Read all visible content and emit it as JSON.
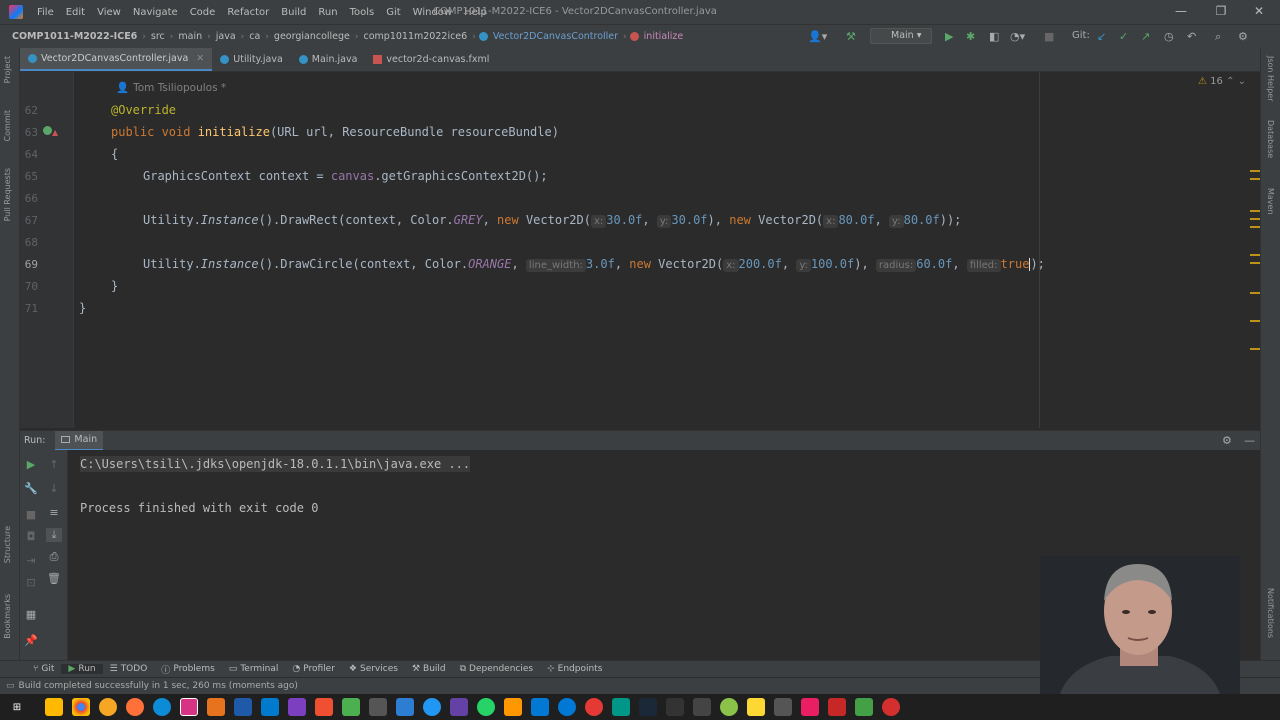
{
  "menu": [
    "File",
    "Edit",
    "View",
    "Navigate",
    "Code",
    "Refactor",
    "Build",
    "Run",
    "Tools",
    "Git",
    "Window",
    "Help"
  ],
  "window_title": "COMP1011-M2022-ICE6 - Vector2DCanvasController.java",
  "window_controls": {
    "minimize": "—",
    "maximize": "❐",
    "close": "✕"
  },
  "breadcrumbs": [
    "COMP1011-M2022-ICE6",
    "src",
    "main",
    "java",
    "ca",
    "georgiancollege",
    "comp1011m2022ice6",
    "Vector2DCanvasController",
    "initialize"
  ],
  "toolbar": {
    "run_config": "Main",
    "git_label": "Git:"
  },
  "tabs": [
    "Vector2DCanvasController.java",
    "Utility.java",
    "Main.java",
    "vector2d-canvas.fxml"
  ],
  "left_stripe": [
    "Project",
    "Commit",
    "Pull Requests",
    "Structure",
    "Bookmarks"
  ],
  "right_stripe": [
    "Json Helper",
    "Database",
    "Maven",
    "Notifications"
  ],
  "editor": {
    "author": "Tom Tsiliopoulos *",
    "warnings_count": "16",
    "line_numbers": [
      "62",
      "63",
      "64",
      "65",
      "66",
      "67",
      "68",
      "69",
      "70",
      "71"
    ],
    "code": {
      "l62": "@Override",
      "l63_kw": "public void ",
      "l63_fn": "initialize",
      "l63_rest": "(URL url, ResourceBundle resourceBundle)",
      "l64": "{",
      "l65_a": "GraphicsContext context = ",
      "l65_field": "canvas",
      "l65_b": ".getGraphicsContext2D();",
      "util": "Utility.",
      "instance": "Instance",
      "l67_call": "().DrawRect(context, Color.",
      "l67_color": "GREY",
      "new": "new",
      "vec": " Vector2D(",
      "hint_x": "x:",
      "hint_y": "y:",
      "l67_x1": "30.0f",
      "l67_y1": "30.0f",
      "l67_x2": "80.0f",
      "l67_y2": "80.0f",
      "close_paren": ")",
      "comma": ", ",
      "l67_end": "));",
      "l69_call": "().DrawCircle(context, Color.",
      "l69_color": "ORANGE",
      "hint_line_width": "line_width:",
      "l69_lw": "3.0f",
      "l69_x": "200.0f",
      "l69_y": "100.0f",
      "hint_radius": "radius:",
      "l69_radius": "60.0f",
      "hint_filled": "filled:",
      "l69_filled": "true",
      "l69_end": ");",
      "l70": "}",
      "l71": "}"
    }
  },
  "run": {
    "label": "Run:",
    "config": "Main",
    "command": "C:\\Users\\tsili\\.jdks\\openjdk-18.0.1.1\\bin\\java.exe ...",
    "result": "Process finished with exit code 0"
  },
  "bottom_tabs": [
    "Git",
    "Run",
    "TODO",
    "Problems",
    "Terminal",
    "Profiler",
    "Services",
    "Build",
    "Dependencies",
    "Endpoints"
  ],
  "status": {
    "message": "Build completed successfully in 1 sec, 260 ms (moments ago)",
    "position": "69"
  },
  "colors": {
    "accent": "#4a88c7",
    "keyword": "#cc7832",
    "function": "#ffc66d",
    "annotation": "#bbb529",
    "number": "#6897bb",
    "constant": "#9876aa"
  }
}
